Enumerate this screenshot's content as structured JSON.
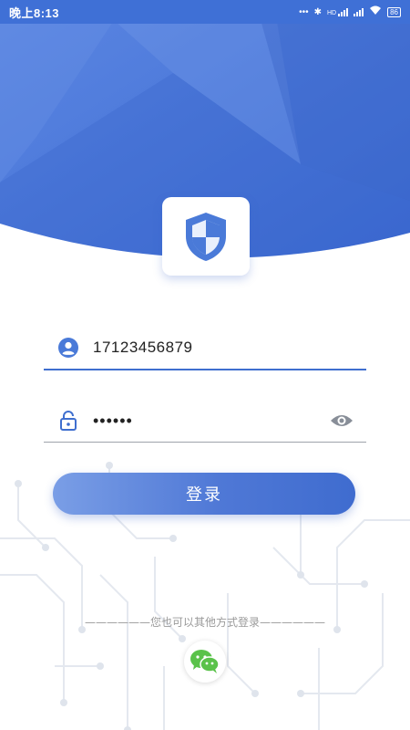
{
  "status_bar": {
    "time": "晚上8:13",
    "dots": "•••",
    "bluetooth": "✱",
    "network_tag": "HD",
    "battery": "86",
    "colors": {
      "bar": "#3f70d6"
    }
  },
  "login_form": {
    "username": {
      "value": "17123456879",
      "icon": "user-icon"
    },
    "password": {
      "value": "••••••",
      "icon": "lock-icon",
      "toggle_icon": "eye-icon"
    },
    "submit_label": "登录"
  },
  "other_login": {
    "divider_text": "——————您也可以其他方式登录——————",
    "wechat_icon": "wechat-icon"
  },
  "colors": {
    "accent": "#3f6fcf",
    "header_blue": "#4a7ad8",
    "icon_grey": "#888e98"
  }
}
